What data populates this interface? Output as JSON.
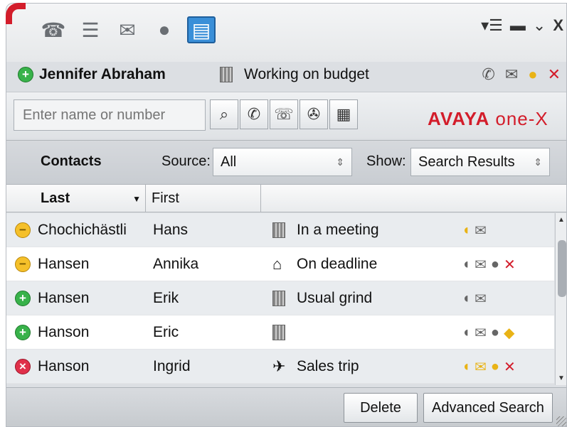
{
  "window": {
    "mode_icons": [
      "phone-icon",
      "contacts-list-icon",
      "voicemail-icon",
      "im-bubble-icon",
      "directory-book-icon"
    ],
    "controls": {
      "menu": "▾☰",
      "minimize": "▬",
      "collapse": "⌄",
      "close": "X"
    }
  },
  "user": {
    "name": "Jennifer Abraham",
    "status_text": "Working on budget",
    "presence": "available"
  },
  "search": {
    "placeholder": "Enter name or number"
  },
  "brand": {
    "avaya": "AVAYA",
    "onex": "one-X"
  },
  "filters": {
    "contacts_label": "Contacts",
    "source_label": "Source:",
    "source_value": "All",
    "show_label": "Show:",
    "show_value": "Search Results"
  },
  "columns": {
    "last": "Last",
    "first": "First"
  },
  "contacts": [
    {
      "last": "Chochichästli",
      "first": "Hans",
      "location": "building",
      "status": "In a meeting",
      "presence": "busy"
    },
    {
      "last": "Hansen",
      "first": "Annika",
      "location": "home",
      "status": "On deadline",
      "presence": "busy"
    },
    {
      "last": "Hansen",
      "first": "Erik",
      "location": "building",
      "status": "Usual grind",
      "presence": "available"
    },
    {
      "last": "Hanson",
      "first": "Eric",
      "location": "building",
      "status": "",
      "presence": "available"
    },
    {
      "last": "Hanson",
      "first": "Ingrid",
      "location": "travel",
      "status": "Sales trip",
      "presence": "dnd"
    }
  ],
  "buttons": {
    "delete": "Delete",
    "advanced_search": "Advanced Search"
  },
  "colors": {
    "brand_red": "#d31d2b",
    "available": "#38b24a",
    "busy": "#f5c02a",
    "dnd": "#e0304a",
    "selected_mode": "#3a8fd8"
  }
}
